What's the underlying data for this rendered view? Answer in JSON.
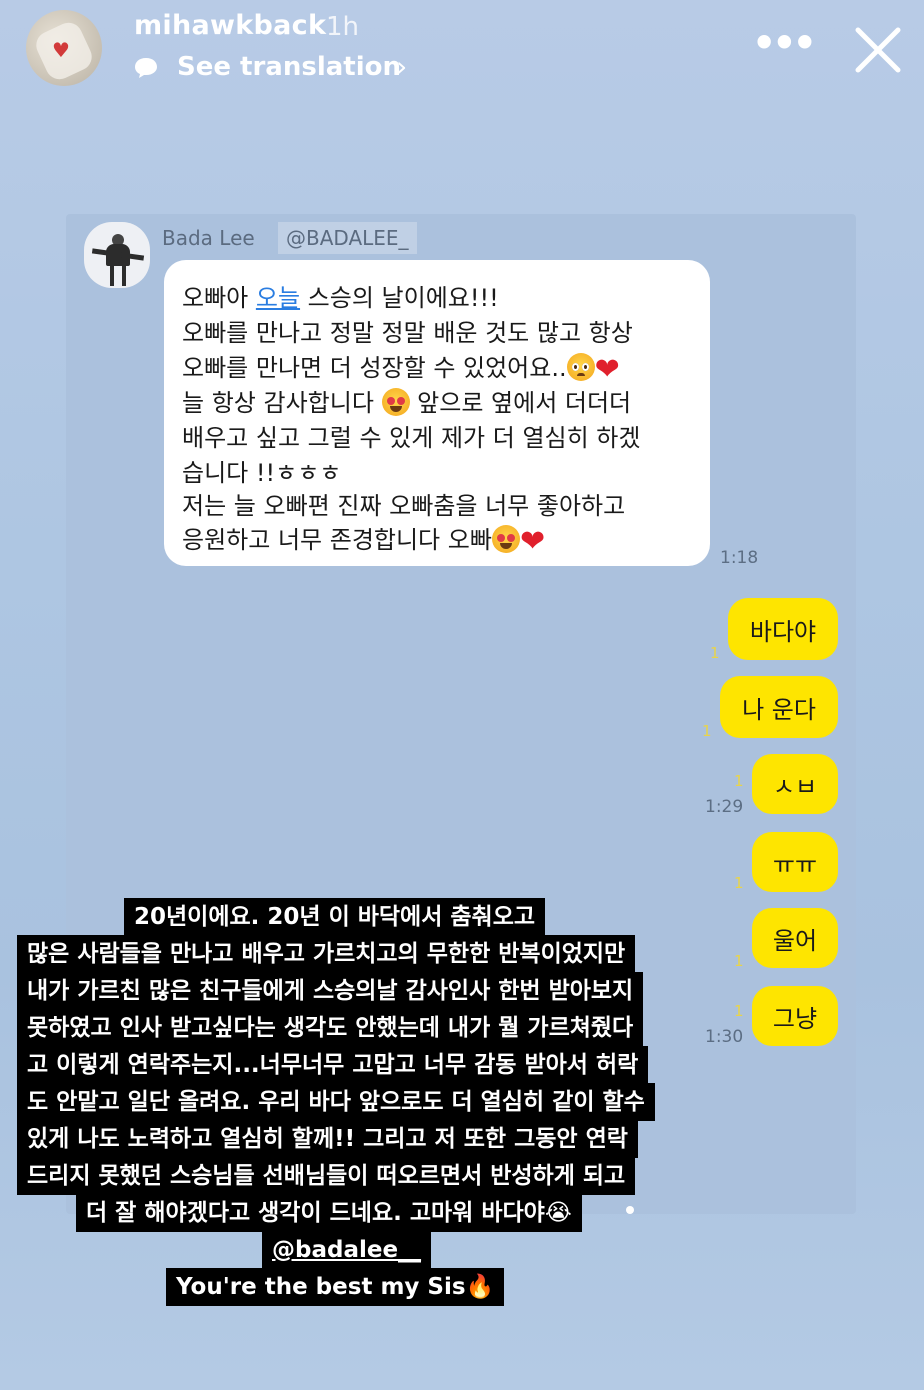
{
  "story": {
    "username": "mihawkback",
    "time": "1h",
    "translate_label": "See translation"
  },
  "chat": {
    "friend_name": "Bada Lee",
    "friend_handle": "@BADALEE_",
    "message_lines": [
      {
        "parts": [
          "오빠아 ",
          "오늘",
          " 스승의 날이에요!!!"
        ]
      },
      {
        "text": "오빠를 만나고 정말 정말 배운 것도 많고 항상"
      },
      {
        "text": "오빠를 만나면 더 성장할 수 있었어요.."
      },
      {
        "parts": [
          "늘 항상 감사합니다 ",
          " 앞으로 옆에서 더더더"
        ]
      },
      {
        "text": "배우고 싶고 그럴 수 있게 제가 더 열심히 하겠"
      },
      {
        "text": "습니다 !!ㅎㅎㅎ"
      },
      {
        "text": "저는 늘 오빠편 진짜 오빠춤을 너무 좋아하고"
      },
      {
        "text": "응원하고 너무 존경합니다 오빠"
      }
    ],
    "message_time": "1:18",
    "replies": [
      {
        "text": "바다야",
        "read": "1"
      },
      {
        "text": "나 운다",
        "read": "1"
      },
      {
        "text": "ㅅㅂ",
        "read": "1"
      },
      {
        "text": "ㅠㅠ",
        "read": "1"
      },
      {
        "text": "울어",
        "read": "1"
      },
      {
        "text": "그냥",
        "read": "1"
      }
    ],
    "reply_times": [
      "1:29",
      "1:30"
    ]
  },
  "caption": {
    "lines": [
      "20년이에요. 20년 이 바닥에서 춤춰오고",
      "많은 사람들을 만나고 배우고 가르치고의 무한한 반복이었지만",
      "내가 가르친 많은 친구들에게 스승의날 감사인사 한번 받아보지",
      "못하였고 인사 받고싶다는 생각도 안했는데 내가 뭘 가르쳐줬다",
      "고 이렇게 연락주는지...너무너무 고맙고 너무 감동 받아서 허락",
      "도 안맡고 일단 올려요. 우리 바다 앞으로도 더 열심히 같이 할수",
      "있게 나도 노력하고 열심히 할께!! 그리고 저 또한 그동안 연락",
      "드리지 못했던 스승님들 선배님들이 떠오르면서 반성하게 되고",
      "더 잘 해야겠다고 생각이 드네요. 고마워 바다야😭"
    ],
    "mention": "@badalee__",
    "closing": "You're the best my Sis🔥"
  },
  "colors": {
    "background": "#aec6e2",
    "kakao_yellow": "#fee500",
    "caption_bg": "#000000"
  }
}
